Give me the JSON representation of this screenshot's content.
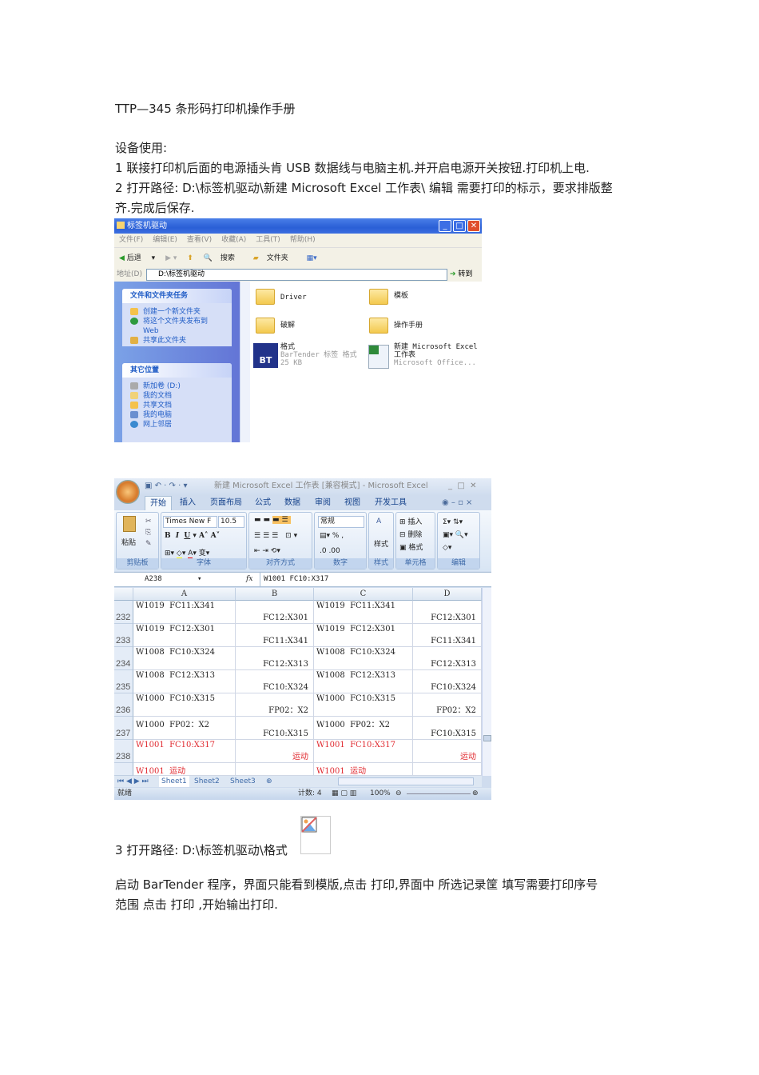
{
  "doc": {
    "title": "TTP—345 条形码打印机操作手册",
    "section": "设备使用:",
    "step1": "1 联接打印机后面的电源插头肯 USB 数据线与电脑主机.并开启电源开关按钮.打印机上电.",
    "step2_line1": "2 打开路径: D:\\标签机驱动\\新建 Microsoft Excel 工作表\\ 编辑 需要打印的标示，要求排版整",
    "step2_line2": "齐.完成后保存.",
    "step3": "3 打开路径: D:\\标签机驱动\\格式",
    "para_line1": "启动 BarTender 程序，界面只能看到模版,点击 打印,界面中  所选记录筐 填写需要打印序号",
    "para_line2": "范围  点击 打印 ,开始输出打印."
  },
  "explorer": {
    "title": "标签机驱动",
    "menu": [
      "文件(F)",
      "编辑(E)",
      "查看(V)",
      "收藏(A)",
      "工具(T)",
      "帮助(H)"
    ],
    "toolbar": {
      "back": "后退",
      "search": "搜索",
      "folders": "文件夹"
    },
    "address_label": "地址(D)",
    "address": "D:\\标签机驱动",
    "go": "转到",
    "tasks_title": "文件和文件夹任务",
    "tasks": [
      "创建一个新文件夹",
      "将这个文件夹发布到 Web",
      "共享此文件夹"
    ],
    "places_title": "其它位置",
    "places": [
      "新加卷 (D:)",
      "我的文档",
      "共享文档",
      "我的电脑",
      "网上邻居"
    ],
    "files": [
      {
        "name": "Driver"
      },
      {
        "name": "模板"
      },
      {
        "name": "破解"
      },
      {
        "name": "操作手册"
      },
      {
        "name": "格式",
        "type": "BarTender 标签 格式",
        "size": "25 KB"
      },
      {
        "name": "新建 Microsoft Excel 工作表",
        "type": "Microsoft Office..."
      }
    ]
  },
  "excel": {
    "title": "新建 Microsoft Excel 工作表  [兼容模式] - Microsoft Excel",
    "tabs": [
      "开始",
      "插入",
      "页面布局",
      "公式",
      "数据",
      "审阅",
      "视图",
      "开发工具"
    ],
    "font": "Times New F",
    "size": "10.5",
    "number_format": "常规",
    "groups": {
      "clipboard": "剪贴板",
      "font": "字体",
      "align": "对齐方式",
      "number": "数字",
      "styles": "样式",
      "cells": "单元格",
      "edit": "编辑"
    },
    "paste": "粘贴",
    "style_btn": "样式",
    "cells_btns": [
      "插入",
      "删除",
      "格式"
    ],
    "name_box": "A238",
    "formula": "W1001   FC10:X317",
    "columns": [
      "A",
      "B",
      "C",
      "D"
    ],
    "rows": [
      {
        "n": "232",
        "a": "W1019  FC11:X341",
        "b": "FC12:X301",
        "c": "W1019  FC11:X341",
        "d": "FC12:X301",
        "red": false
      },
      {
        "n": "233",
        "a": "W1019  FC12:X301",
        "b": "FC11:X341",
        "c": "W1019  FC12:X301",
        "d": "FC11:X341",
        "red": false
      },
      {
        "n": "234",
        "a": "W1008  FC10:X324",
        "b": "FC12:X313",
        "c": "W1008  FC10:X324",
        "d": "FC12:X313",
        "red": false
      },
      {
        "n": "235",
        "a": "W1008  FC12:X313",
        "b": "FC10:X324",
        "c": "W1008  FC12:X313",
        "d": "FC10:X324",
        "red": false
      },
      {
        "n": "236",
        "a": "W1000  FC10:X315",
        "b": "FP02：X2",
        "c": "W1000  FC10:X315",
        "d": "FP02：X2",
        "red": false
      },
      {
        "n": "237",
        "a": "W1000  FP02：X2",
        "b": "FC10:X315",
        "c": "W1000  FP02：X2",
        "d": "FC10:X315",
        "red": false
      },
      {
        "n": "238",
        "a": "W1001  FC10:X317",
        "b": "运动",
        "c": "W1001  FC10:X317",
        "d": "运动",
        "red": true
      },
      {
        "n": "",
        "a": "W1001  运动",
        "b": "",
        "c": "W1001  运动",
        "d": "",
        "red": true
      }
    ],
    "sheets": [
      "Sheet1",
      "Sheet2",
      "Sheet3"
    ],
    "status": {
      "ready": "就绪",
      "count": "计数: 4",
      "zoom": "100%"
    }
  }
}
